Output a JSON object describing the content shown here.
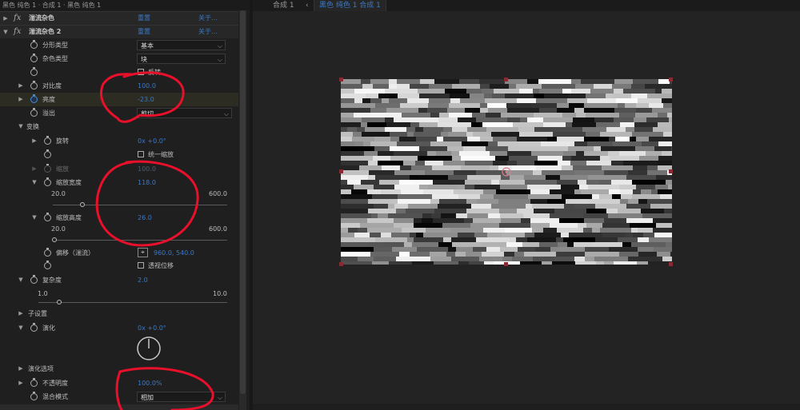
{
  "breadcrumb": "黑色 纯色 1 · 合成 1 · 黑色 纯色 1",
  "effects": [
    {
      "name": "湍流杂色",
      "reset": "重置",
      "about": "关于..."
    },
    {
      "name": "湍流杂色 2",
      "reset": "重置",
      "about": "关于..."
    }
  ],
  "props": {
    "fractal_type": {
      "label": "分形类型",
      "value": "基本"
    },
    "noise_type": {
      "label": "杂色类型",
      "value": "块"
    },
    "invert": {
      "label": "反转"
    },
    "contrast": {
      "label": "对比度",
      "value": "100.0"
    },
    "brightness": {
      "label": "亮度",
      "value": "-23.0"
    },
    "overflow": {
      "label": "溢出",
      "value": "剪切"
    },
    "transform": {
      "label": "变换"
    },
    "rotation": {
      "label": "旋转",
      "value": "0x +0.0°"
    },
    "uniform_scale": {
      "label": "统一缩放"
    },
    "scale": {
      "label": "缩放",
      "value": "100.0"
    },
    "scale_width": {
      "label": "缩放宽度",
      "value": "118.0",
      "min": "20.0",
      "max": "600.0",
      "level": 0.17
    },
    "scale_height": {
      "label": "缩放高度",
      "value": "26.0",
      "min": "20.0",
      "max": "600.0",
      "level": 0.01
    },
    "offset": {
      "label": "偏移（湍流）",
      "value": "960.0, 540.0"
    },
    "perspective_offset": {
      "label": "透视位移"
    },
    "complexity": {
      "label": "复杂度",
      "value": "2.0",
      "min": "1.0",
      "max": "10.0",
      "level": 0.11
    },
    "sub_settings": {
      "label": "子设置"
    },
    "evolution": {
      "label": "演化",
      "value": "0x +0.0°"
    },
    "evolution_options": {
      "label": "演化选项"
    },
    "opacity": {
      "label": "不透明度",
      "value": "100.0%"
    },
    "blend_mode": {
      "label": "混合模式",
      "value": "相加"
    }
  },
  "viewer": {
    "tab_comp": "合成 1",
    "tab_layer": "黑色 纯色 1 合成 1"
  },
  "colors": {
    "accent_blue": "#3a78c8",
    "annotation_red": "#e8102a",
    "handle": "#8a2a35"
  }
}
